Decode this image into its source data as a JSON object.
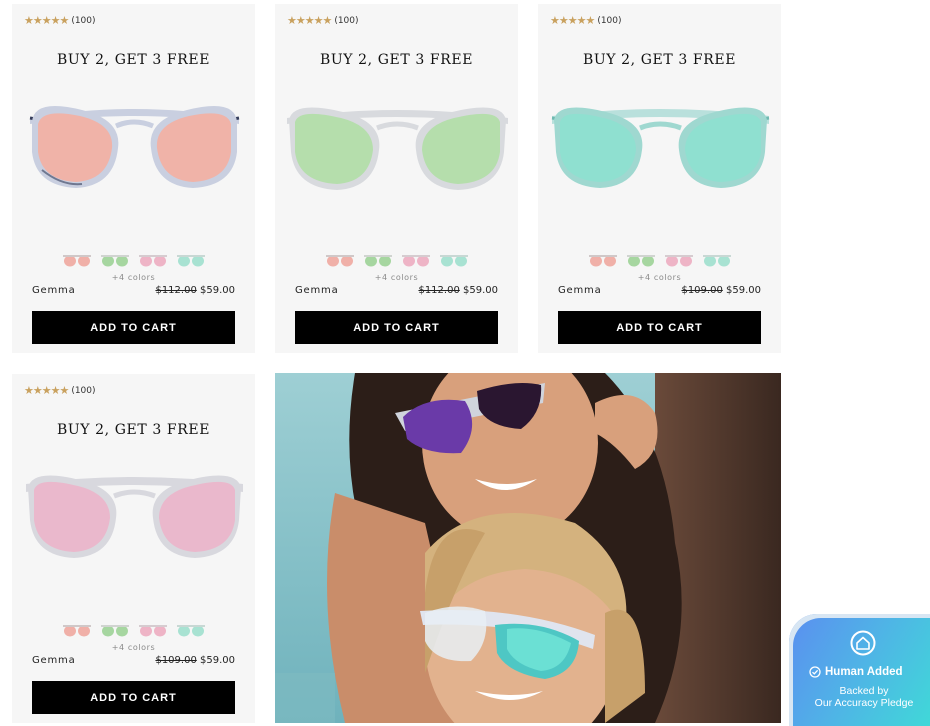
{
  "products": [
    {
      "rating_stars": "★★★★★",
      "rating_count": "(100)",
      "promo": "BUY 2, GET 3 FREE",
      "lens_color": "#f0b3a8",
      "frame_color": "#c9cfe0",
      "frame_dark": "#343c5a",
      "swatches": [
        "#f0b0a8",
        "#a6d6a0",
        "#eeb4c6",
        "#a8e2d2"
      ],
      "more_colors": "+4 colors",
      "name": "Gemma",
      "old_price": "$112.00",
      "price": "$59.00",
      "cta": "ADD TO CART"
    },
    {
      "rating_stars": "★★★★★",
      "rating_count": "(100)",
      "promo": "BUY 2, GET 3 FREE",
      "lens_color": "#b5deac",
      "frame_color": "#d8dade",
      "frame_dark": "#9aa0a8",
      "swatches": [
        "#f0b0a8",
        "#a6d6a0",
        "#eeb4c6",
        "#a8e2d2"
      ],
      "more_colors": "+4 colors",
      "name": "Gemma",
      "old_price": "$112.00",
      "price": "$59.00",
      "cta": "ADD TO CART"
    },
    {
      "rating_stars": "★★★★★",
      "rating_count": "(100)",
      "promo": "BUY 2, GET 3 FREE",
      "lens_color": "#8fe0d0",
      "frame_color": "#b9e0dc",
      "frame_dark": "#6fb8b0",
      "swatches": [
        "#f0b0a8",
        "#a6d6a0",
        "#eeb4c6",
        "#a8e2d2"
      ],
      "more_colors": "+4 colors",
      "name": "Gemma",
      "old_price": "$109.00",
      "price": "$59.00",
      "cta": "ADD TO CART"
    },
    {
      "rating_stars": "★★★★★",
      "rating_count": "(100)",
      "promo": "BUY 2, GET 3 FREE",
      "lens_color": "#eab8cc",
      "frame_color": "#d8d8de",
      "frame_dark": "#a4a4b0",
      "swatches": [
        "#f0b0a8",
        "#a6d6a0",
        "#eeb4c6",
        "#a8e2d2"
      ],
      "more_colors": "+4 colors",
      "name": "Gemma",
      "old_price": "$109.00",
      "price": "$59.00",
      "cta": "ADD TO CART"
    }
  ],
  "badge": {
    "title": "Human Added",
    "subtitle_line1": "Backed by",
    "subtitle_line2": "Our Accuracy Pledge",
    "colors": [
      "#5b8ef0",
      "#40d8d8"
    ]
  }
}
